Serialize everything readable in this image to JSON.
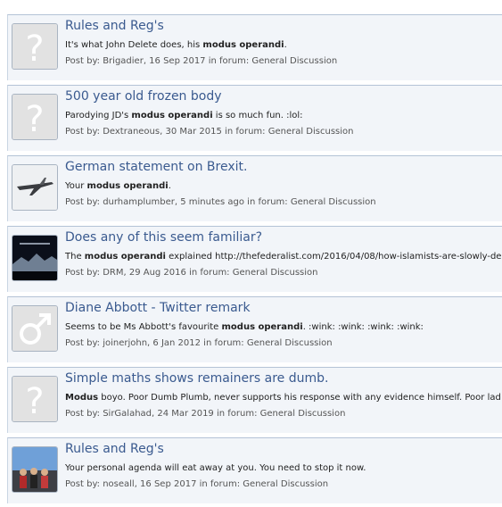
{
  "results": [
    {
      "title": "Rules and Reg's",
      "snippet_pre": "It's what John Delete does, his ",
      "snippet_hl": "modus operandi",
      "snippet_post": ".",
      "meta_prefix": "Post by: ",
      "author": "Brigadier",
      "date": ", 16 Sep 2017 in forum: ",
      "forum": "General Discussion",
      "avatar": "question-mark"
    },
    {
      "title": "500 year old frozen body",
      "snippet_pre": "Parodying JD's ",
      "snippet_hl": "modus operandi",
      "snippet_post": " is so much fun. :lol:",
      "meta_prefix": "Post by: ",
      "author": "Dextraneous",
      "date": ", 30 Mar 2015 in forum: ",
      "forum": "General Discussion",
      "avatar": "question-mark"
    },
    {
      "title": "German statement on Brexit.",
      "snippet_pre": "Your ",
      "snippet_hl": "modus operandi",
      "snippet_post": ".",
      "meta_prefix": "Post by: ",
      "author": "durhamplumber",
      "date": ", 5 minutes ago in forum: ",
      "forum": "General Discussion",
      "avatar": "airplane"
    },
    {
      "title": "Does any of this seem familiar?",
      "snippet_pre": "The ",
      "snippet_hl": "modus operandi",
      "snippet_post": " explained http://thefederalist.com/2016/04/08/how-islamists-are-slowly-de",
      "meta_prefix": "Post by: ",
      "author": "DRM",
      "date": ", 29 Aug 2016 in forum: ",
      "forum": "General Discussion",
      "avatar": "dark-landscape"
    },
    {
      "title": "Diane Abbott - Twitter remark",
      "snippet_pre": "Seems to be Ms Abbott's favourite ",
      "snippet_hl": "modus operandi",
      "snippet_post": ". :wink: :wink: :wink: :wink:",
      "meta_prefix": "Post by: ",
      "author": "joinerjohn",
      "date": ", 6 Jan 2012 in forum: ",
      "forum": "General Discussion",
      "avatar": "male-symbol"
    },
    {
      "title": "Simple maths shows remainers are dumb.",
      "snippet_pre": "",
      "snippet_hl": "Modus",
      "snippet_post": " boyo. Poor Dumb Plumb, never supports his response with any evidence himself. Poor lad lo",
      "meta_prefix": "Post by: ",
      "author": "SirGalahad",
      "date": ", 24 Mar 2019 in forum: ",
      "forum": "General Discussion",
      "avatar": "question-mark"
    },
    {
      "title": "Rules and Reg's",
      "snippet_pre": "Your personal agenda will eat away at you. You need to stop it now.",
      "snippet_hl": "",
      "snippet_post": "",
      "meta_prefix": "Post by: ",
      "author": "noseall",
      "date": ", 16 Sep 2017 in forum: ",
      "forum": "General Discussion",
      "avatar": "group-photo"
    }
  ]
}
